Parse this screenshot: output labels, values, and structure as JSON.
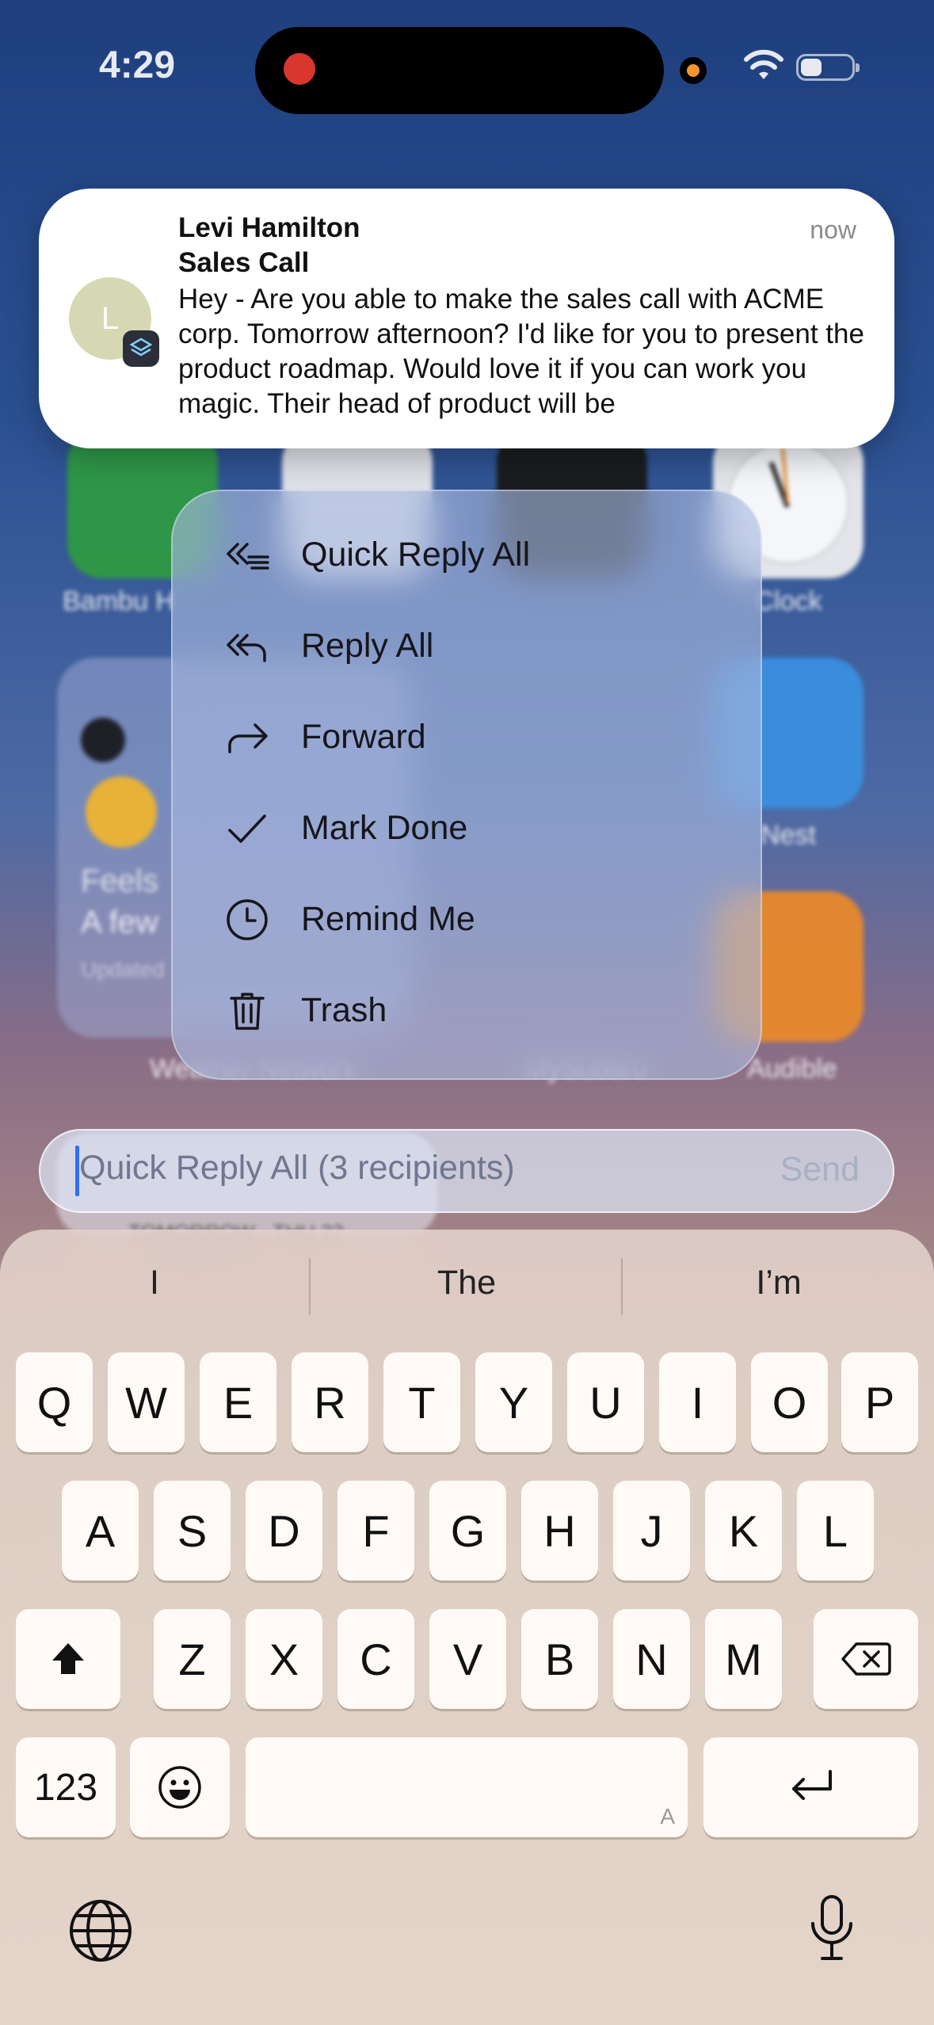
{
  "status_bar": {
    "time": "4:29"
  },
  "home_screen": {
    "labels": {
      "bambu": "Bambu H",
      "clock": "Clock",
      "nest": "Nest",
      "audible": "Audible",
      "weather_widget": "Weather Network",
      "my_subaru": "MySubaru"
    },
    "weather_widget": {
      "feels": "Feels",
      "summary": "A few",
      "updated": "Updated"
    },
    "calendar_widget": {
      "header": "TOMORROW · THU 22"
    }
  },
  "notification": {
    "avatar_initial": "L",
    "sender": "Levi Hamilton",
    "subject": "Sales Call",
    "time": "now",
    "preview": "Hey - Are you able to make the sales call with ACME corp. Tomorrow afternoon? I'd like for you to present the product roadmap. Would love it if you can work you magic. Their head of product will be"
  },
  "context_menu": {
    "items": [
      {
        "label": "Quick Reply All",
        "icon": "quick-reply-all-icon"
      },
      {
        "label": "Reply All",
        "icon": "reply-all-icon"
      },
      {
        "label": "Forward",
        "icon": "forward-icon"
      },
      {
        "label": "Mark Done",
        "icon": "checkmark-icon"
      },
      {
        "label": "Remind Me",
        "icon": "clock-icon"
      },
      {
        "label": "Trash",
        "icon": "trash-icon"
      }
    ]
  },
  "quick_reply": {
    "placeholder": "Quick Reply All (3 recipients)",
    "send_label": "Send"
  },
  "keyboard": {
    "suggestions": [
      "I",
      "The",
      "I’m"
    ],
    "row1": [
      "Q",
      "W",
      "E",
      "R",
      "T",
      "Y",
      "U",
      "I",
      "O",
      "P"
    ],
    "row2": [
      "A",
      "S",
      "D",
      "F",
      "G",
      "H",
      "J",
      "K",
      "L"
    ],
    "row3": [
      "Z",
      "X",
      "C",
      "V",
      "B",
      "N",
      "M"
    ],
    "numbers_label": "123",
    "space_hint": "A"
  },
  "colors": {
    "accent": "#2f6ff0",
    "record": "#d9362e",
    "camera_indicator": "#f2952f"
  }
}
